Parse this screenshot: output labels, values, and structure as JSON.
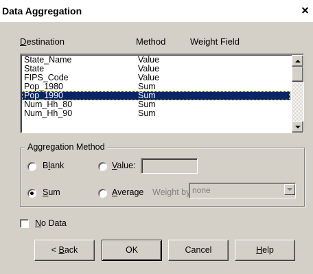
{
  "window": {
    "title": "Data Aggregation"
  },
  "headers": {
    "destination": "Destination",
    "method": "Method",
    "weight_field": "Weight Field"
  },
  "list": {
    "rows": [
      {
        "destination": "State_Name",
        "method": "Value"
      },
      {
        "destination": "State",
        "method": "Value"
      },
      {
        "destination": "FIPS_Code",
        "method": "Value"
      },
      {
        "destination": "Pop_1980",
        "method": "Sum"
      },
      {
        "destination": "Pop_1990",
        "method": "Sum"
      },
      {
        "destination": "Num_Hh_80",
        "method": "Sum"
      },
      {
        "destination": "Num_Hh_90",
        "method": "Sum"
      }
    ],
    "selected_index": 4
  },
  "aggregation": {
    "group_label": "Aggregation Method",
    "blank_label": "Blank",
    "value_label": "Value:",
    "sum_label": "Sum",
    "average_label": "Average",
    "weight_by_label": "Weight by:",
    "weight_by_value": "none",
    "selected": "sum"
  },
  "no_data": {
    "label": "No Data",
    "checked": false
  },
  "buttons": {
    "back": "< Back",
    "ok": "OK",
    "cancel": "Cancel",
    "help": "Help"
  },
  "colors": {
    "selection": "#0a246a",
    "dialog_bg": "#d4d0c8"
  }
}
